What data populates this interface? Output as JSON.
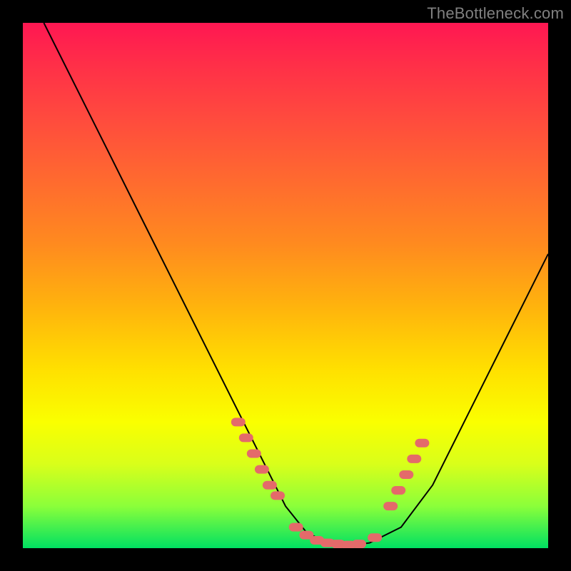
{
  "watermark": "TheBottleneck.com",
  "chart_data": {
    "type": "line",
    "title": "",
    "xlabel": "",
    "ylabel": "",
    "xlim": [
      0,
      100
    ],
    "ylim": [
      0,
      100
    ],
    "grid": false,
    "series": [
      {
        "name": "curve",
        "x": [
          4,
          10,
          16,
          22,
          28,
          34,
          40,
          46,
          50,
          54,
          58,
          62,
          66,
          72,
          78,
          84,
          90,
          96,
          100
        ],
        "y": [
          100,
          88,
          76,
          64,
          52,
          40,
          28,
          16,
          8,
          3,
          1,
          0.5,
          1,
          4,
          12,
          24,
          36,
          48,
          56
        ]
      }
    ],
    "markers": {
      "name": "red-dots",
      "x": [
        41,
        42.5,
        44,
        45.5,
        47,
        48.5,
        52,
        54,
        56,
        58,
        60,
        62,
        64,
        67,
        70,
        71.5,
        73,
        74.5,
        76
      ],
      "y": [
        24,
        21,
        18,
        15,
        12,
        10,
        4,
        2.5,
        1.5,
        1,
        0.8,
        0.6,
        0.8,
        2,
        8,
        11,
        14,
        17,
        20
      ]
    },
    "background_gradient": {
      "direction": "top-to-bottom",
      "stops": [
        {
          "pos": 0.0,
          "color": "#ff1752"
        },
        {
          "pos": 0.3,
          "color": "#ff6a2f"
        },
        {
          "pos": 0.6,
          "color": "#ffe000"
        },
        {
          "pos": 0.85,
          "color": "#d9ff1a"
        },
        {
          "pos": 1.0,
          "color": "#00e062"
        }
      ]
    }
  }
}
